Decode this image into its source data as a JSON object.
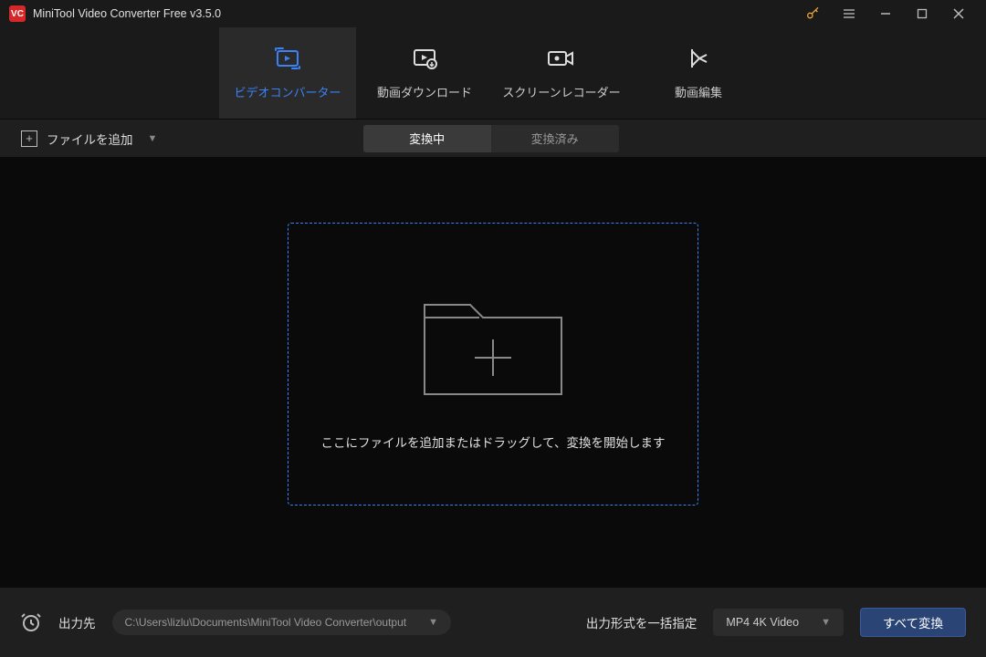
{
  "titlebar": {
    "app_title": "MiniTool Video Converter Free v3.5.0",
    "logo_text": "VC"
  },
  "main_tabs": {
    "video_converter": "ビデオコンバーター",
    "video_download": "動画ダウンロード",
    "screen_recorder": "スクリーンレコーダー",
    "video_edit": "動画編集"
  },
  "subbar": {
    "add_file_label": "ファイルを追加",
    "converting_label": "変換中",
    "converted_label": "変換済み"
  },
  "dropzone": {
    "hint": "ここにファイルを追加またはドラッグして、変換を開始します"
  },
  "bottombar": {
    "output_dest_label": "出力先",
    "output_path": "C:\\Users\\lizlu\\Documents\\MiniTool Video Converter\\output",
    "output_format_label": "出力形式を一括指定",
    "output_format_value": "MP4 4K Video",
    "convert_all_label": "すべて変換"
  }
}
